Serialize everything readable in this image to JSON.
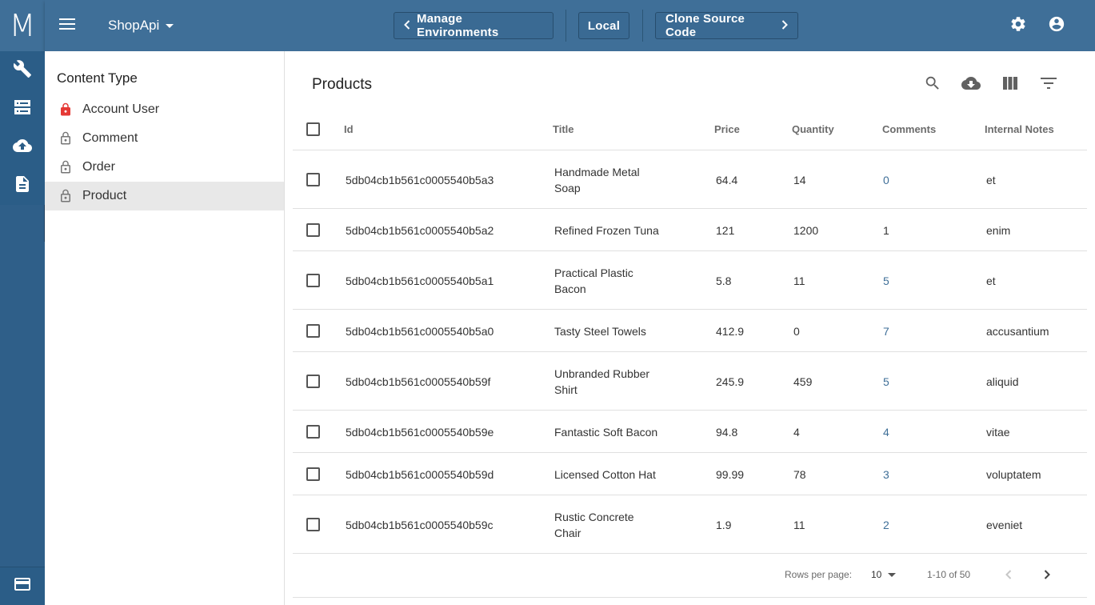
{
  "rail": {
    "logo": "M",
    "items": [
      {
        "icon": "wrench-icon"
      },
      {
        "icon": "server-icon"
      },
      {
        "icon": "cloud-upload-icon"
      },
      {
        "icon": "document-icon"
      }
    ],
    "bottom_icon": "credit-card-icon"
  },
  "topbar": {
    "project": "ShopApi",
    "manage_environments": "Manage Environments",
    "environment": "Local",
    "clone_source_code": "Clone Source Code"
  },
  "sidebar": {
    "title": "Content Type",
    "items": [
      {
        "label": "Account User",
        "locked": true
      },
      {
        "label": "Comment",
        "locked": false
      },
      {
        "label": "Order",
        "locked": false
      },
      {
        "label": "Product",
        "locked": false,
        "selected": true
      }
    ]
  },
  "main": {
    "title": "Products",
    "columns": [
      "Id",
      "Title",
      "Price",
      "Quantity",
      "Comments",
      "Internal Notes"
    ],
    "rows": [
      {
        "id": "5db04cb1b561c0005540b5a3",
        "title_lines": [
          "Handmade Metal",
          "Soap"
        ],
        "price": "64.4",
        "quantity": "14",
        "comments": "0",
        "notes": "et",
        "comments_link": true
      },
      {
        "id": "5db04cb1b561c0005540b5a2",
        "title_lines": [
          "Refined Frozen Tuna"
        ],
        "price": "121",
        "quantity": "1200",
        "comments": "1",
        "notes": "enim",
        "comments_link": false
      },
      {
        "id": "5db04cb1b561c0005540b5a1",
        "title_lines": [
          "Practical Plastic",
          "Bacon"
        ],
        "price": "5.8",
        "quantity": "11",
        "comments": "5",
        "notes": "et",
        "comments_link": true
      },
      {
        "id": "5db04cb1b561c0005540b5a0",
        "title_lines": [
          "Tasty Steel Towels"
        ],
        "price": "412.9",
        "quantity": "0",
        "comments": "7",
        "notes": "accusantium",
        "comments_link": true
      },
      {
        "id": "5db04cb1b561c0005540b59f",
        "title_lines": [
          "Unbranded Rubber",
          "Shirt"
        ],
        "price": "245.9",
        "quantity": "459",
        "comments": "5",
        "notes": "aliquid",
        "comments_link": true
      },
      {
        "id": "5db04cb1b561c0005540b59e",
        "title_lines": [
          "Fantastic Soft Bacon"
        ],
        "price": "94.8",
        "quantity": "4",
        "comments": "4",
        "notes": "vitae",
        "comments_link": true
      },
      {
        "id": "5db04cb1b561c0005540b59d",
        "title_lines": [
          "Licensed Cotton Hat"
        ],
        "price": "99.99",
        "quantity": "78",
        "comments": "3",
        "notes": "voluptatem",
        "comments_link": true
      },
      {
        "id": "5db04cb1b561c0005540b59c",
        "title_lines": [
          "Rustic Concrete",
          "Chair"
        ],
        "price": "1.9",
        "quantity": "11",
        "comments": "2",
        "notes": "eveniet",
        "comments_link": true
      }
    ],
    "pagination": {
      "rows_per_page_label": "Rows per page:",
      "rows_per_page": "10",
      "range": "1-10 of 50"
    }
  },
  "colors": {
    "header": "#3f6f98",
    "rail": "#2b5d87",
    "link": "#3f6f98",
    "lock_red": "#e53935"
  }
}
